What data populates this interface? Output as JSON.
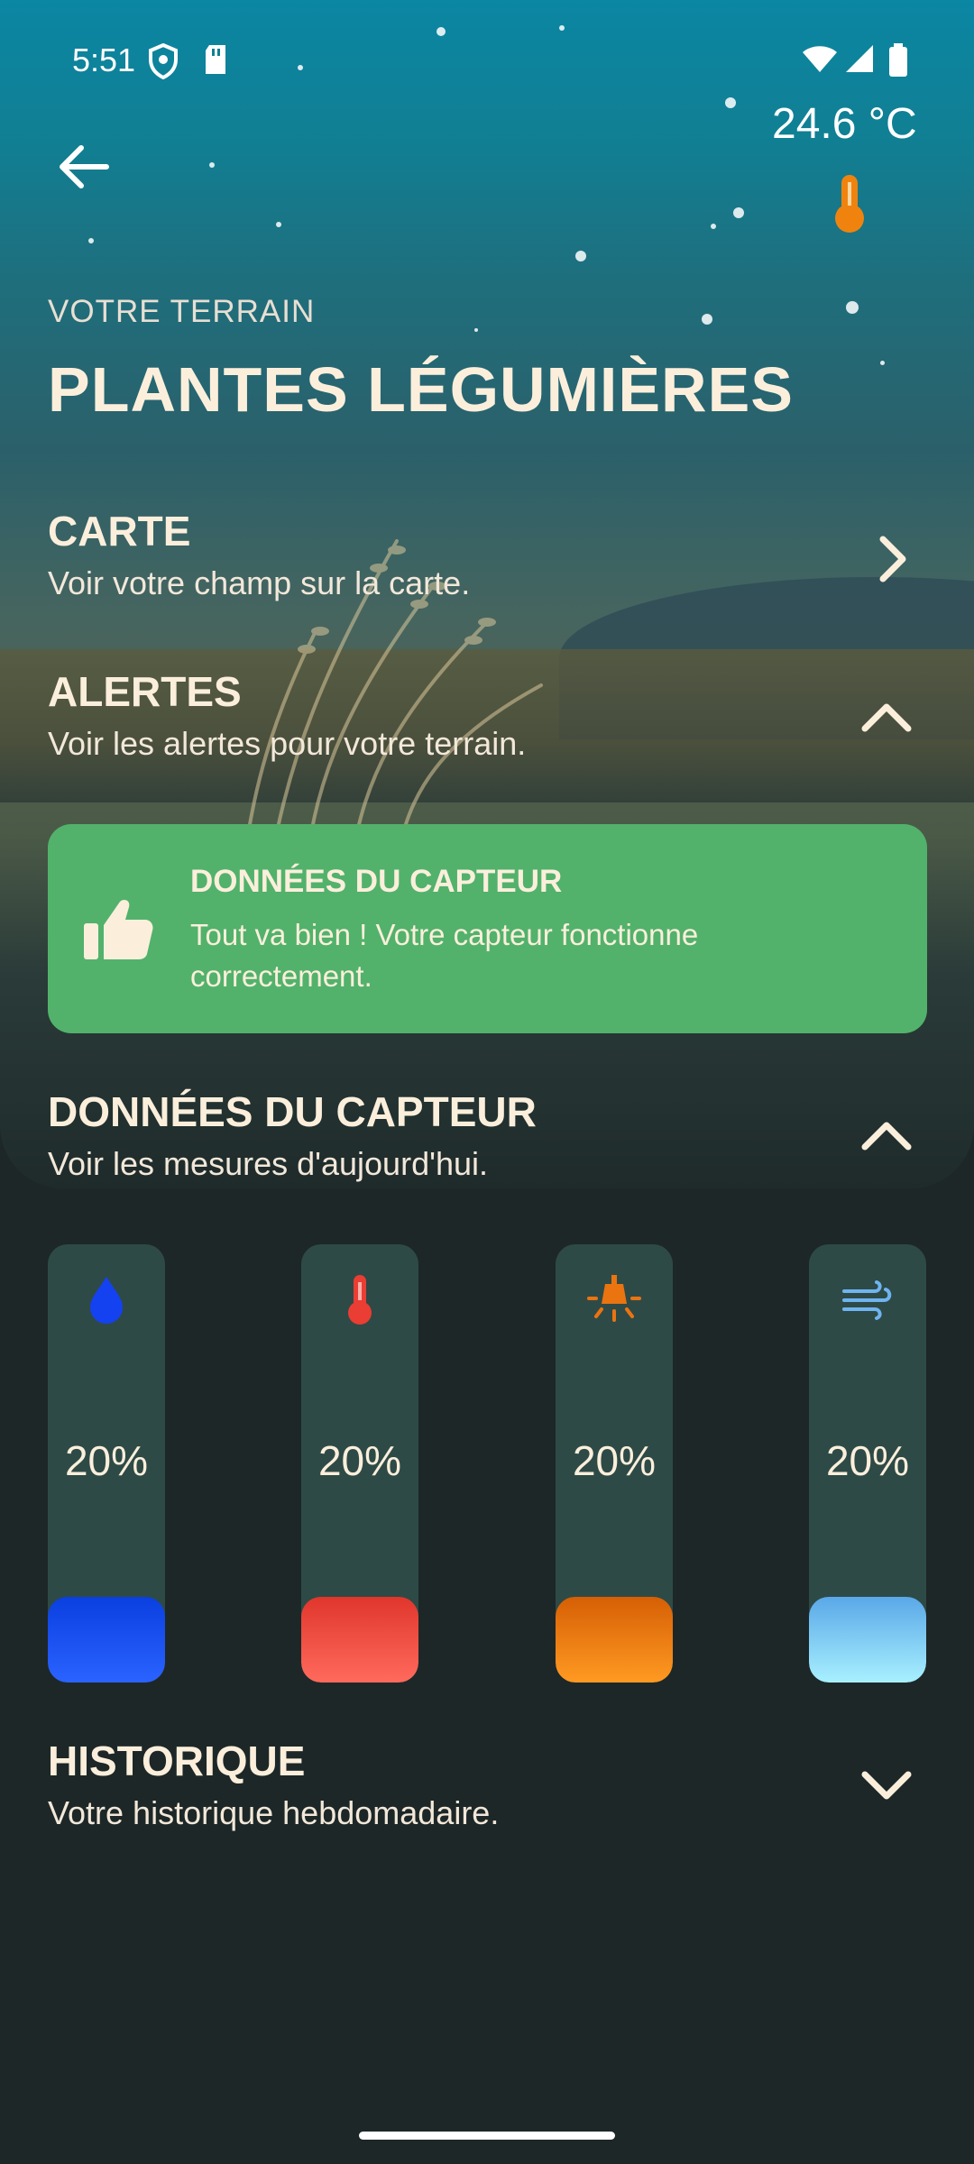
{
  "status_bar": {
    "time": "5:51",
    "icons": [
      "shield-icon",
      "sd-card-icon",
      "wifi-icon",
      "signal-icon",
      "battery-icon"
    ]
  },
  "header": {
    "back_icon": "arrow-left-icon",
    "temperature": "24.6 °C",
    "temperature_icon": "thermometer-icon",
    "terrain_label": "VOTRE TERRAIN",
    "terrain_title": "PLANTES LÉGUMIÈRES"
  },
  "sections": {
    "carte": {
      "title": "CARTE",
      "subtitle": "Voir votre champ sur la carte.",
      "icon": "chevron-right-icon"
    },
    "alertes": {
      "title": "ALERTES",
      "subtitle": "Voir les alertes pour votre terrain.",
      "icon": "chevron-up-icon"
    },
    "capteur": {
      "title": "DONNÉES DU CAPTEUR",
      "subtitle": "Voir les mesures d'aujourd'hui.",
      "icon": "chevron-up-icon"
    },
    "historique": {
      "title": "HISTORIQUE",
      "subtitle": "Votre historique hebdomadaire.",
      "icon": "chevron-down-icon"
    }
  },
  "alert_card": {
    "icon": "thumbs-up-icon",
    "title": "DONNÉES DU CAPTEUR",
    "text": "Tout va bien ! Votre capteur fonctionne correctement.",
    "color": "#52b26b"
  },
  "gauges": [
    {
      "name": "humidity",
      "icon": "water-drop-icon",
      "value_label": "20%",
      "level": 0.2,
      "color_top": "#0a3fe0",
      "color_bottom": "#2a63ff"
    },
    {
      "name": "temperature",
      "icon": "thermometer-icon",
      "value_label": "20%",
      "level": 0.2,
      "color_top": "#e0362c",
      "color_bottom": "#ff6a5c"
    },
    {
      "name": "light",
      "icon": "lamp-icon",
      "value_label": "20%",
      "level": 0.2,
      "color_top": "#d65f05",
      "color_bottom": "#ff9a22"
    },
    {
      "name": "wind",
      "icon": "wind-icon",
      "value_label": "20%",
      "level": 0.2,
      "color_top": "#5aa8e8",
      "color_bottom": "#a8f0ff"
    }
  ]
}
